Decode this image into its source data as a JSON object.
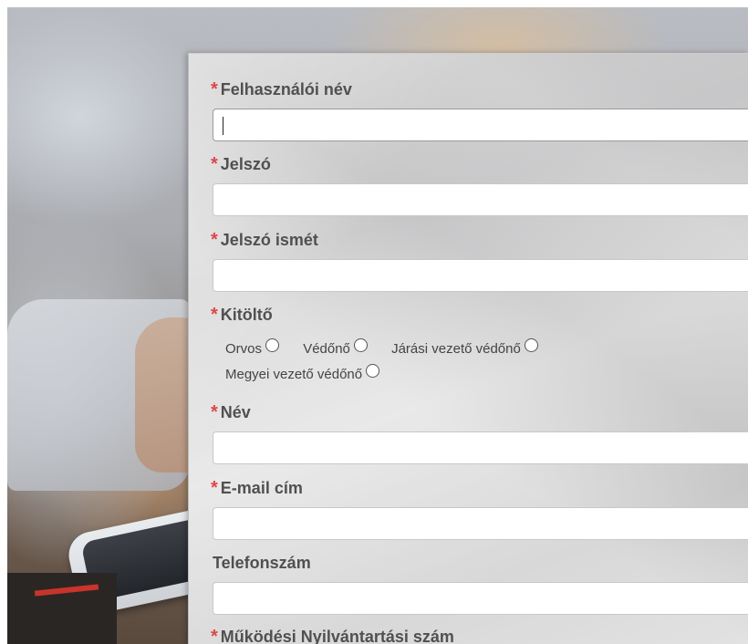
{
  "form": {
    "fields": [
      {
        "label": "Felhasználói név",
        "required": true,
        "value": "",
        "focused": true
      },
      {
        "label": "Jelszó",
        "required": true,
        "value": ""
      },
      {
        "label": "Jelszó ismét",
        "required": true,
        "value": ""
      },
      {
        "label": "Név",
        "required": true,
        "value": ""
      },
      {
        "label": "E-mail cím",
        "required": true,
        "value": ""
      },
      {
        "label": "Telefonszám",
        "required": false,
        "value": ""
      },
      {
        "label": "Működési Nyilvántartási szám",
        "required": true
      }
    ],
    "required_marker": "*",
    "role": {
      "label": "Kitöltő",
      "required": true,
      "options": [
        "Orvos",
        "Védőnő",
        "Járási vezető védőnő",
        "Megyei vezető védőnő"
      ],
      "selected": null
    }
  },
  "colors": {
    "required_marker": "#e0454a",
    "label_text": "#505050"
  }
}
